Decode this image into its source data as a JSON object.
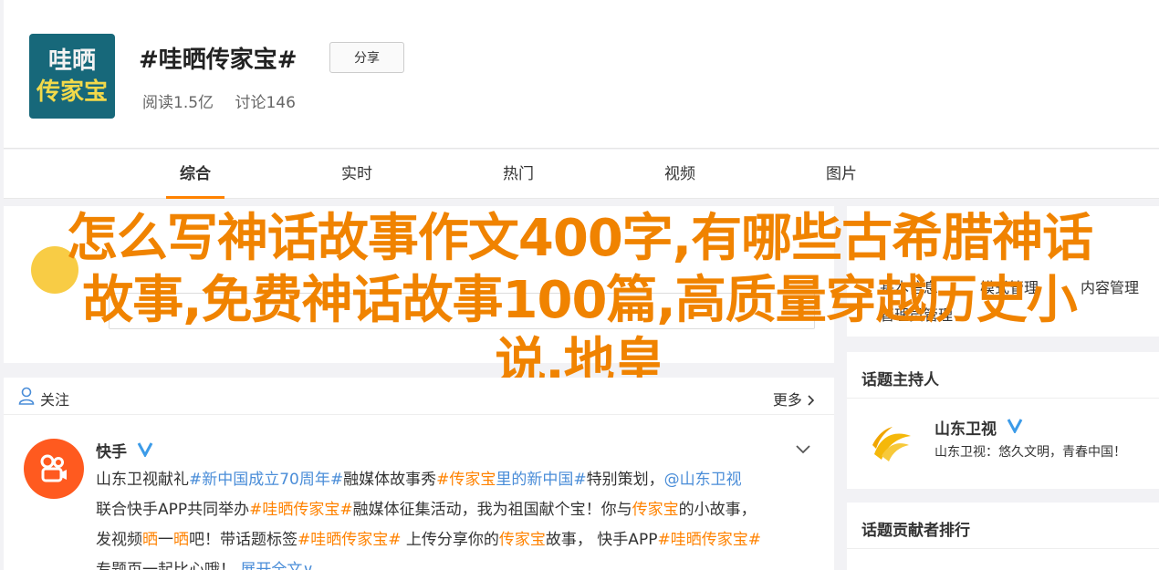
{
  "topic": {
    "logo_line1": "哇晒",
    "logo_line2": "传家宝",
    "title": "#哇晒传家宝#",
    "share_label": "分享",
    "reads": "阅读1.5亿",
    "discussions": "讨论146"
  },
  "tabs": [
    {
      "label": "综合",
      "active": true
    },
    {
      "label": "实时",
      "active": false
    },
    {
      "label": "热门",
      "active": false
    },
    {
      "label": "视频",
      "active": false
    },
    {
      "label": "图片",
      "active": false
    }
  ],
  "overlay_title": {
    "line1": "怎么写神话故事作文400字,有哪些古希腊神话",
    "line2": "故事,免费神话故事100篇,高质量穿越历史小",
    "line3": "说,地皇"
  },
  "manage": {
    "basic": "基本信息",
    "mode": "模式管理",
    "content": "内容管理",
    "admin": "管理员管理"
  },
  "feed": {
    "follow_label": "关注",
    "more_label": "更多",
    "post": {
      "author": "快手",
      "line1": [
        {
          "t": "山东卫视献礼",
          "c": ""
        },
        {
          "t": "#新中国成立70周年#",
          "c": "blue"
        },
        {
          "t": "融媒体故事秀",
          "c": ""
        },
        {
          "t": "#传家宝",
          "c": "tag"
        },
        {
          "t": "里的新中国#",
          "c": "blue"
        },
        {
          "t": "特别策划，",
          "c": ""
        },
        {
          "t": "@山东卫视",
          "c": "mention"
        }
      ],
      "line2": [
        {
          "t": "联合快手APP共同举办",
          "c": ""
        },
        {
          "t": "#哇晒传家宝#",
          "c": "tag"
        },
        {
          "t": "融媒体征集活动，我为祖国献个宝！你与",
          "c": ""
        },
        {
          "t": "传家宝",
          "c": "tag"
        },
        {
          "t": "的小故事，",
          "c": ""
        }
      ],
      "line3": [
        {
          "t": "发视频",
          "c": ""
        },
        {
          "t": "晒",
          "c": "tag"
        },
        {
          "t": "一",
          "c": ""
        },
        {
          "t": "晒",
          "c": "tag"
        },
        {
          "t": "吧！带话题标签",
          "c": ""
        },
        {
          "t": "#哇晒传家宝#",
          "c": "tag"
        },
        {
          "t": " 上传分享你的",
          "c": ""
        },
        {
          "t": "传家宝",
          "c": "tag"
        },
        {
          "t": "故事，  快手APP",
          "c": ""
        },
        {
          "t": "#哇晒传家宝#",
          "c": "tag"
        }
      ],
      "line4": [
        {
          "t": "专题页一起比心哦！",
          "c": ""
        },
        {
          "t": "  展开全文∨",
          "c": "blue"
        }
      ]
    }
  },
  "host": {
    "section_title": "话题主持人",
    "name": "山东卫视",
    "desc": "山东卫视：悠久文明，青春中国！"
  },
  "ranking": {
    "section_title": "话题贡献者排行"
  },
  "colors": {
    "accent": "#ff8200",
    "link": "#4a8dd8",
    "overlay": "#f08300"
  }
}
